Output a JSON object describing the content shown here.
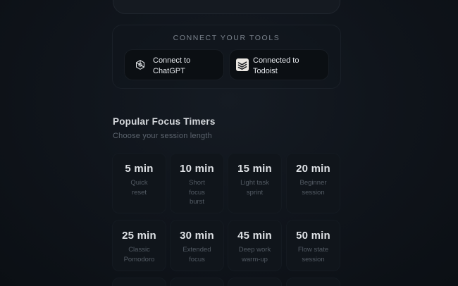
{
  "tools": {
    "title": "CONNECT YOUR TOOLS",
    "chatgpt": {
      "line1": "Connect to",
      "line2": "ChatGPT",
      "icon": "chatgpt-icon"
    },
    "todoist": {
      "line1": "Connected to",
      "line2": "Todoist",
      "icon": "todoist-icon"
    }
  },
  "timers": {
    "title": "Popular Focus Timers",
    "subtitle": "Choose your session length",
    "items": [
      {
        "duration": "5 min",
        "desc1": "Quick",
        "desc2": "reset",
        "desc3": ""
      },
      {
        "duration": "10 min",
        "desc1": "Short",
        "desc2": "focus",
        "desc3": "burst"
      },
      {
        "duration": "15 min",
        "desc1": "Light task",
        "desc2": "sprint",
        "desc3": ""
      },
      {
        "duration": "20 min",
        "desc1": "Beginner",
        "desc2": "session",
        "desc3": ""
      },
      {
        "duration": "25 min",
        "desc1": "Classic",
        "desc2": "Pomodoro",
        "desc3": ""
      },
      {
        "duration": "30 min",
        "desc1": "Extended",
        "desc2": "focus",
        "desc3": ""
      },
      {
        "duration": "45 min",
        "desc1": "Deep work",
        "desc2": "warm-up",
        "desc3": ""
      },
      {
        "duration": "50 min",
        "desc1": "Flow state",
        "desc2": "session",
        "desc3": ""
      }
    ]
  },
  "colors": {
    "background": "#0f141a",
    "card": "#10151b",
    "text_primary": "#dfe2e6",
    "text_muted": "#535b64"
  }
}
